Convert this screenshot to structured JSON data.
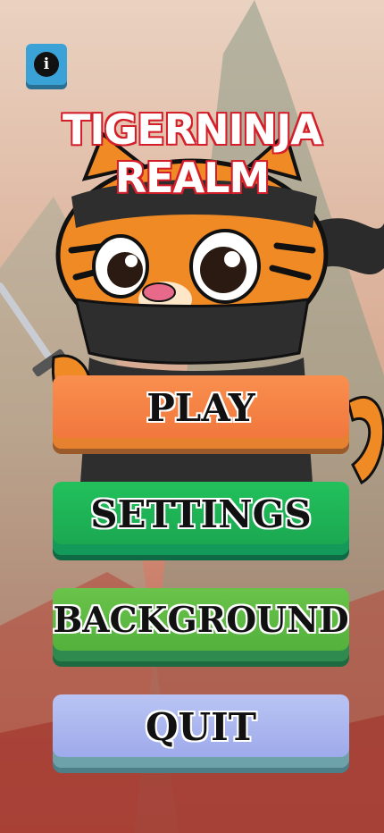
{
  "game": {
    "title_line1": "TIGERNINJA",
    "title_line2": "REALM",
    "info_icon_glyph": "i"
  },
  "menu": {
    "play_label": "PLAY",
    "settings_label": "SETTINGS",
    "background_label": "BACKGROUND",
    "quit_label": "QUIT"
  },
  "colors": {
    "title_outline": "#d41f2a",
    "play": "#f98f4f",
    "settings": "#22c15c",
    "background": "#5fb742",
    "quit": "#a8b3ef",
    "info_button": "#3aa2d6"
  }
}
